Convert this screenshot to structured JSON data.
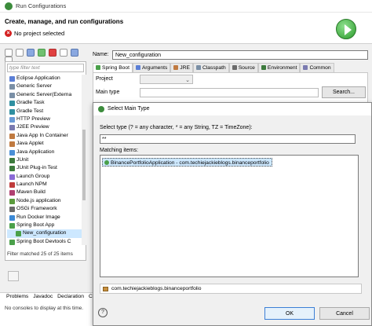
{
  "window": {
    "title": "Run Configurations"
  },
  "banner": {
    "heading": "Create, manage, and run configurations",
    "error": "No project selected"
  },
  "left": {
    "filter_placeholder": "type filter text",
    "items": [
      {
        "label": "Eclipse Application",
        "color": "#5b7fd6",
        "child": false
      },
      {
        "label": "Generic Server",
        "color": "#7a8fa6",
        "child": false
      },
      {
        "label": "Generic Server(Externa",
        "color": "#7a8fa6",
        "child": false
      },
      {
        "label": "Gradle Task",
        "color": "#2f8fa0",
        "child": false
      },
      {
        "label": "Gradle Test",
        "color": "#2f8fa0",
        "child": false
      },
      {
        "label": "HTTP Preview",
        "color": "#6a9ad6",
        "child": false
      },
      {
        "label": "J2EE Preview",
        "color": "#7a7ab0",
        "child": false
      },
      {
        "label": "Java App In Container",
        "color": "#c07a40",
        "child": false
      },
      {
        "label": "Java Applet",
        "color": "#c07a40",
        "child": false
      },
      {
        "label": "Java Application",
        "color": "#4a8fd6",
        "child": false
      },
      {
        "label": "JUnit",
        "color": "#3c7a3c",
        "child": false
      },
      {
        "label": "JUnit Plug-in Test",
        "color": "#3c7a3c",
        "child": false
      },
      {
        "label": "Launch Group",
        "color": "#8a6ad6",
        "child": false
      },
      {
        "label": "Launch NPM",
        "color": "#c03c3c",
        "child": false
      },
      {
        "label": "Maven Build",
        "color": "#b04070",
        "child": false
      },
      {
        "label": "Node.js application",
        "color": "#5a9a3c",
        "child": false
      },
      {
        "label": "OSGi Framework",
        "color": "#6a6a6a",
        "child": false
      },
      {
        "label": "Run Docker Image",
        "color": "#3c8ad6",
        "child": false
      },
      {
        "label": "Spring Boot App",
        "color": "#4aa04a",
        "child": false
      },
      {
        "label": "New_configuration",
        "color": "#4aa04a",
        "child": true,
        "selected": true
      },
      {
        "label": "Spring Boot Devtools C",
        "color": "#4aa04a",
        "child": false
      }
    ],
    "filtered_text": "Filter matched 25 of 25 items"
  },
  "right": {
    "name_label": "Name:",
    "name_value": "New_configuration",
    "tabs": [
      {
        "label": "Spring Boot",
        "color": "#4aa04a"
      },
      {
        "label": "Arguments",
        "color": "#5b7fd6"
      },
      {
        "label": "JRE",
        "color": "#c07a40"
      },
      {
        "label": "Classpath",
        "color": "#7a8fa6"
      },
      {
        "label": "Source",
        "color": "#6a6a6a"
      },
      {
        "label": "Environment",
        "color": "#3c7a3c"
      },
      {
        "label": "Common",
        "color": "#7a7ab0"
      }
    ],
    "project_label": "Project",
    "main_type_label": "Main type",
    "search_button": "Search..."
  },
  "console": {
    "tabs": [
      "Problems",
      "Javadoc",
      "Declaration",
      "Con"
    ],
    "message": "No consoles to display at this time."
  },
  "dialog": {
    "title": "Select Main Type",
    "prompt": "Select type (? = any character, * = any String, TZ = TimeZone):",
    "filter_value": "**",
    "matching_label": "Matching items:",
    "match_item": "BinancePortfolioApplication - com.techiejackieblogs.binanceportfolio",
    "status": "com.techiejackieblogs.binanceportfolio",
    "ok": "OK",
    "cancel": "Cancel",
    "help": "?"
  }
}
